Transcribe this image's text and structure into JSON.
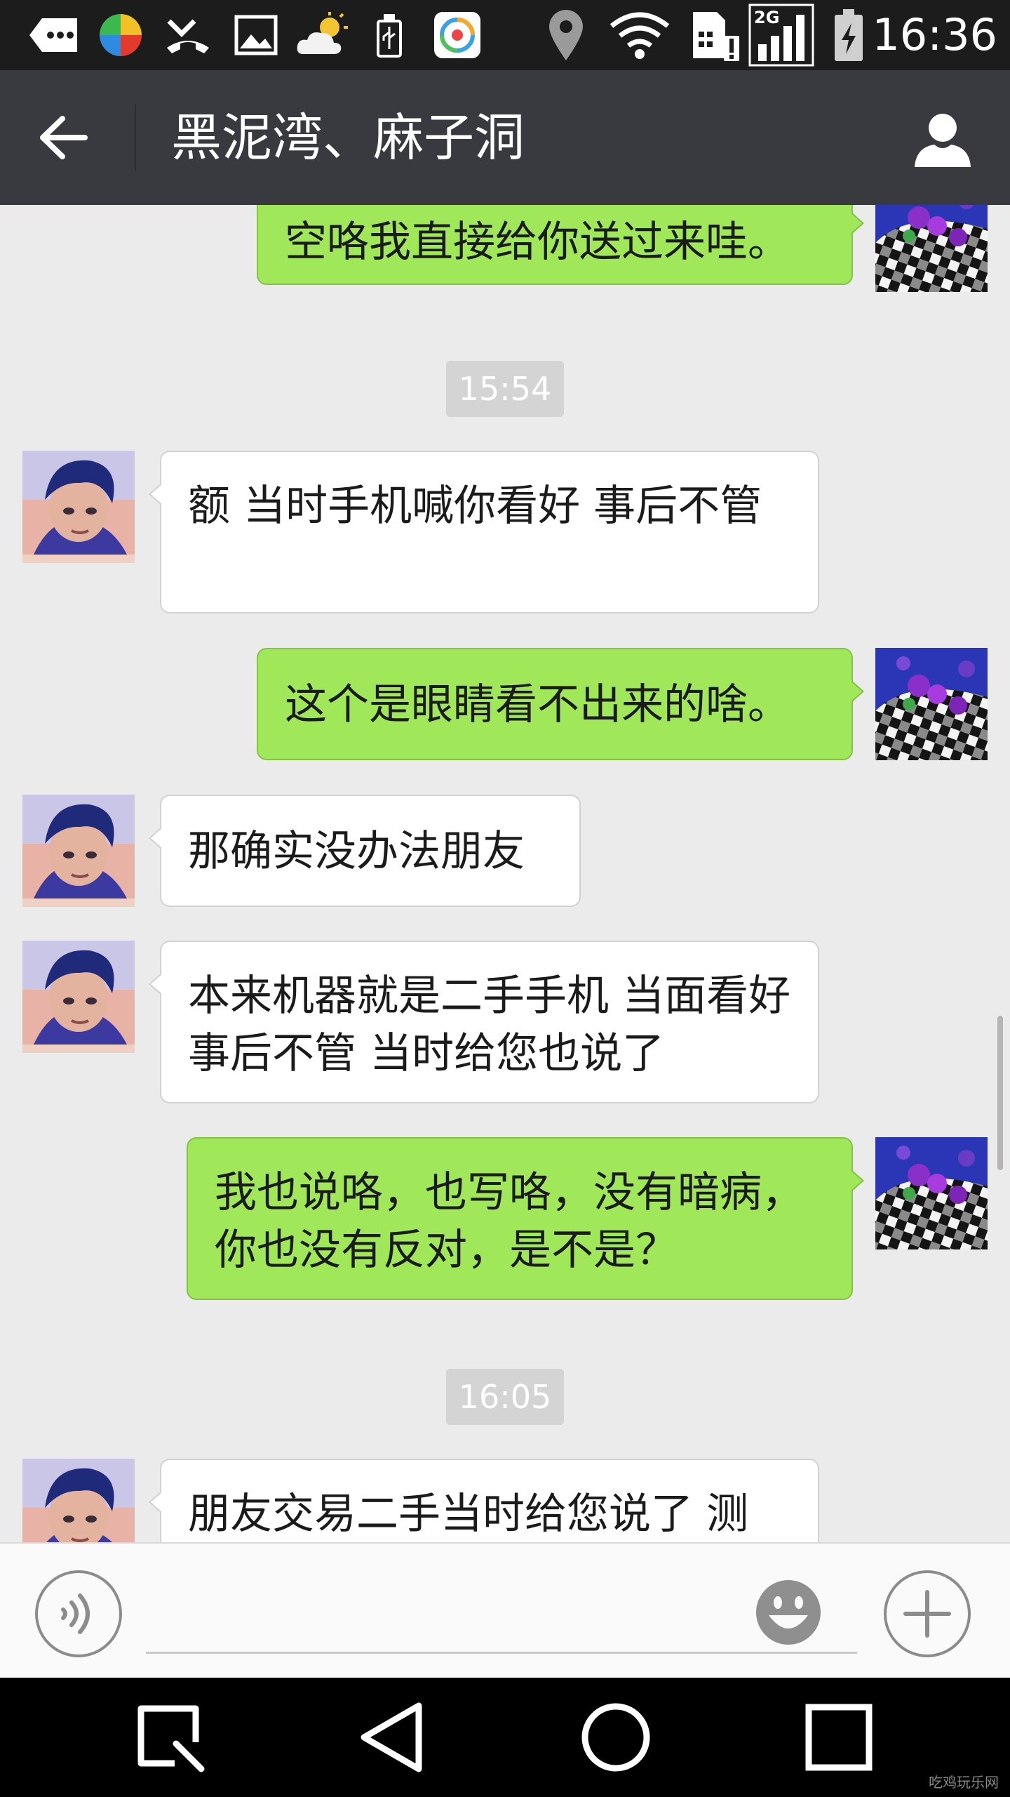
{
  "status_bar": {
    "time": "16:36",
    "network": "2G",
    "icons": [
      "more-icon",
      "pinwheel-app-icon",
      "missed-call-icon",
      "gallery-icon",
      "weather-icon",
      "usb-icon",
      "app-icon",
      "location-icon",
      "wifi-icon",
      "sim-alert-icon",
      "signal-icon",
      "battery-charging-icon"
    ]
  },
  "header": {
    "title": "黑泥湾、麻子洞",
    "back_icon": "arrow-left-icon",
    "profile_icon": "person-icon"
  },
  "colors": {
    "statusbar_bg": "#1c1c1c",
    "header_bg": "#393a3f",
    "chat_bg": "#ebebeb",
    "outgoing_bubble": "#a0e75a",
    "incoming_bubble": "#ffffff",
    "timestamp_bg": "#d4d4d4"
  },
  "messages": [
    {
      "type": "message",
      "direction": "out",
      "text": "空咯我直接给你送过来哇。"
    },
    {
      "type": "timestamp",
      "text": "15:54"
    },
    {
      "type": "message",
      "direction": "in",
      "text": "额  当时手机喊你看好 事后不管"
    },
    {
      "type": "message",
      "direction": "out",
      "text": "这个是眼睛看不出来的啥。"
    },
    {
      "type": "message",
      "direction": "in",
      "text": "那确实没办法朋友"
    },
    {
      "type": "message",
      "direction": "in",
      "text": "本来机器就是二手手机 当面看好 事后不管 当时给您也说了"
    },
    {
      "type": "message",
      "direction": "out",
      "text": "我也说咯，也写咯，没有暗病，你也没有反对，是不是？"
    },
    {
      "type": "timestamp",
      "text": "16:05"
    },
    {
      "type": "message",
      "direction": "in",
      "text": "朋友交易二手当时给您说了 测"
    }
  ],
  "input_bar": {
    "voice_icon": "voice-icon",
    "input_value": "",
    "emoji_icon": "smiley-icon",
    "more_icon": "plus-icon"
  },
  "nav_bar": {
    "icons": [
      "search-nav-icon",
      "back-triangle-icon",
      "home-circle-icon",
      "recents-square-icon"
    ]
  },
  "watermark": "吃鸡玩乐网"
}
